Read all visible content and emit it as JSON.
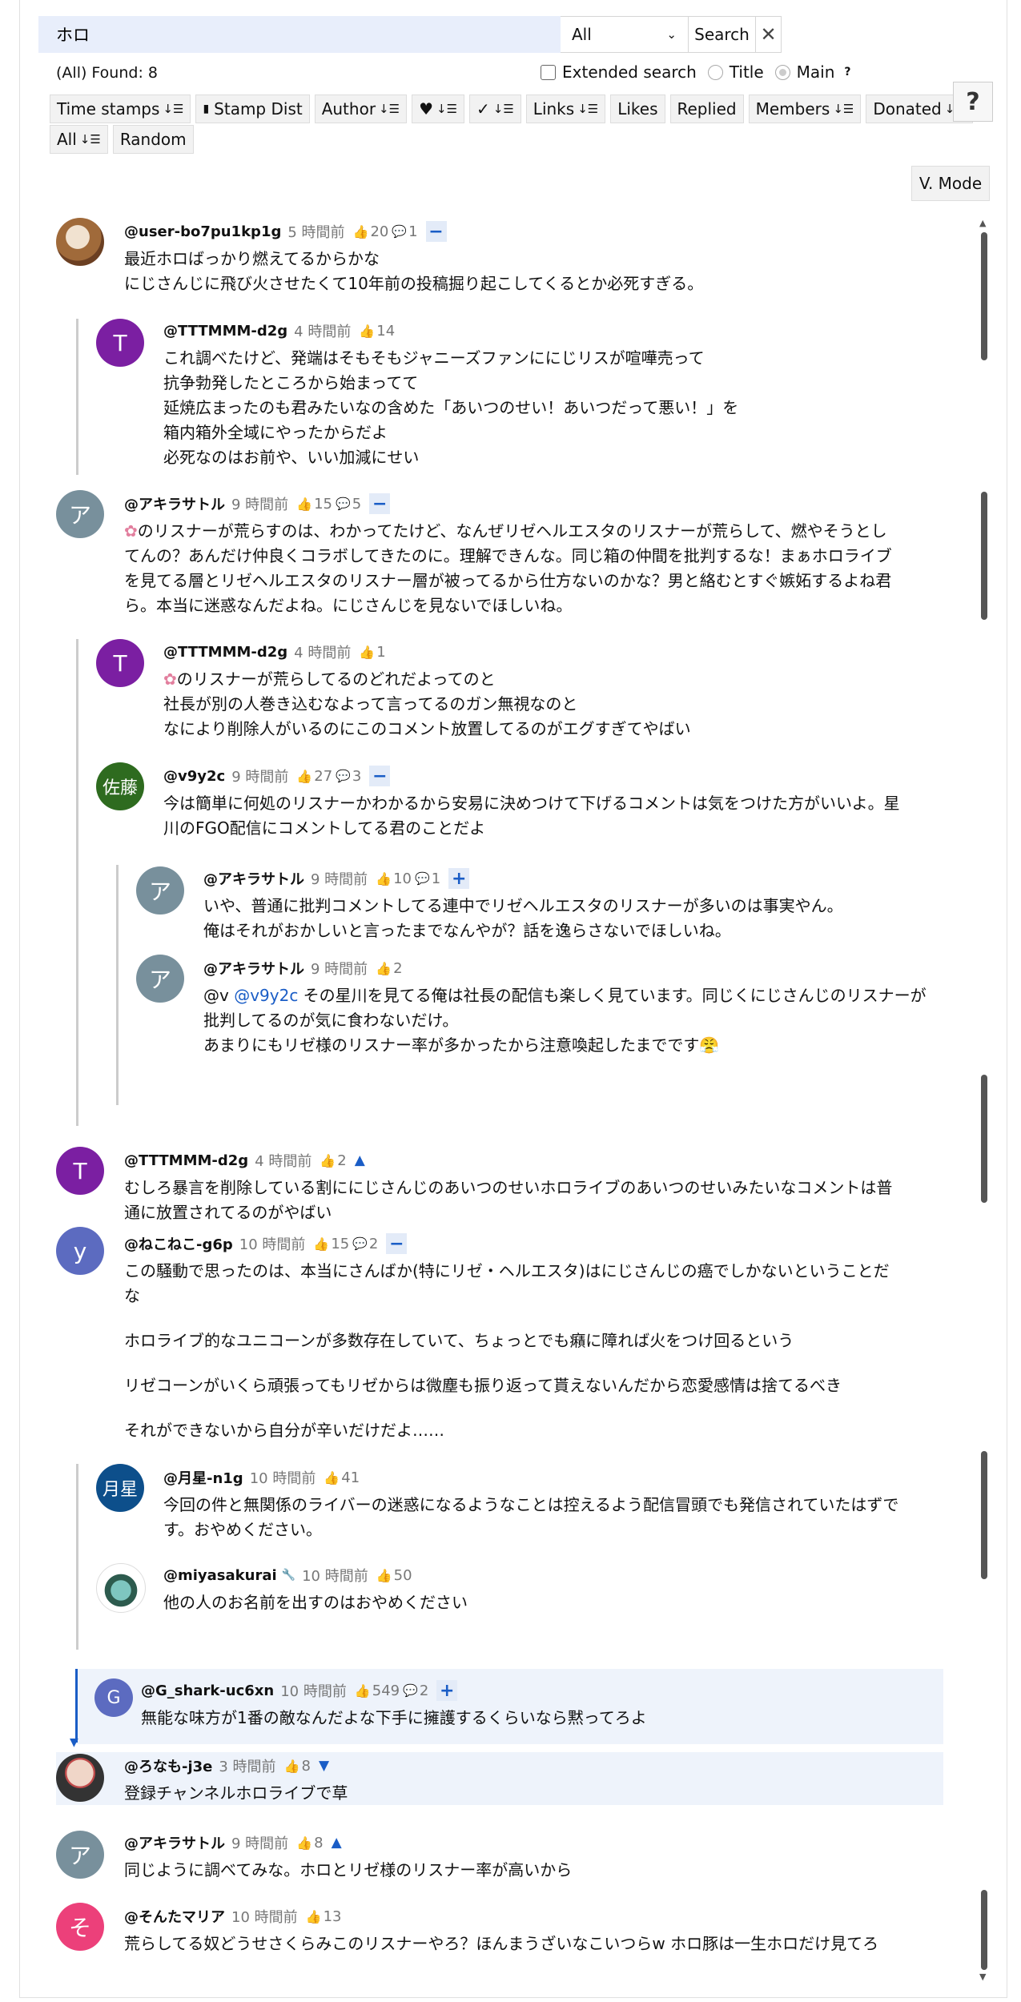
{
  "search": {
    "query": "ホロ",
    "scope": "All",
    "button": "Search",
    "clear": "✕"
  },
  "found_text": "(All) Found: 8",
  "options": {
    "extended": "Extended search",
    "title": "Title",
    "main": "Main",
    "help_q": "?"
  },
  "buttons_row1": [
    {
      "label": "Time stamps",
      "sort": "↓☰"
    },
    {
      "label": "Stamp Dist",
      "prefix": "▮"
    },
    {
      "label": "Author",
      "sort": "↓☰"
    },
    {
      "label": "♥",
      "sort": "↓☰"
    },
    {
      "label": "✓",
      "sort": "↓☰"
    },
    {
      "label": "Links",
      "sort": "↓☰"
    },
    {
      "label": "Likes"
    },
    {
      "label": "Replied"
    },
    {
      "label": "Members",
      "sort": "↓☰"
    },
    {
      "label": "Donated",
      "sort": "↓☰"
    }
  ],
  "buttons_row2": [
    {
      "label": "All",
      "sort": "↓☰"
    },
    {
      "label": "Random"
    }
  ],
  "help_button": "?",
  "vmode": "V. Mode",
  "comments": [
    {
      "author": "@user-bo7pu1kp1g",
      "time": "5 時間前",
      "likes": "20",
      "replies": "1",
      "toggle": "−",
      "lines": [
        "最近ホロばっかり燃えてるからかな",
        "にじさんじに飛び火させたくて10年前の投稿掘り起こしてくるとか必死すぎる。"
      ]
    },
    {
      "author": "@TTTMMM-d2g",
      "avatar": "T",
      "time": "4 時間前",
      "likes": "14",
      "lines": [
        "これ調べたけど、発端はそもそもジャニーズファンににじリスが喧嘩売って",
        "抗争勃発したところから始まってて",
        "延焼広まったのも君みたいなの含めた「あいつのせい！あいつだって悪い！」を",
        "箱内箱外全域にやったからだよ",
        "必死なのはお前や、いい加減にせい"
      ]
    },
    {
      "author": "@アキラサトル",
      "avatar": "ア",
      "time": "9 時間前",
      "likes": "15",
      "replies": "5",
      "toggle": "−",
      "lines": [
        "のリスナーが荒らすのは、わかってたけど、なんぜリゼヘルエスタのリスナーが荒らして、燃やそうとし",
        "てんの？あんだけ仲良くコラボしてきたのに。理解できんな。同じ箱の仲間を批判するな！まぁホロライブ",
        "を見てる層とリゼヘルエスタのリスナー層が被ってるから仕方ないのかな？男と絡むとすぐ嫉妬するよね君",
        "ら。本当に迷惑なんだよね。にじさんじを見ないでほしいね。"
      ]
    },
    {
      "author": "@TTTMMM-d2g",
      "avatar": "T",
      "time": "4 時間前",
      "likes": "1",
      "lines": [
        "のリスナーが荒らしてるのどれだよってのと",
        "社長が別の人巻き込むなよって言ってるのガン無視なのと",
        "なにより削除人がいるのにこのコメント放置してるのがエグすぎてやばい"
      ]
    },
    {
      "author": "@v9y2c",
      "avatar": "佐藤",
      "time": "9 時間前",
      "likes": "27",
      "replies": "3",
      "toggle": "−",
      "lines": [
        "今は簡単に何処のリスナーかわかるから安易に決めつけて下げるコメントは気をつけた方がいいよ。星",
        "川のFGO配信にコメントしてる君のことだよ"
      ]
    },
    {
      "author": "@アキラサトル",
      "avatar": "ア",
      "time": "9 時間前",
      "likes": "10",
      "replies": "1",
      "toggle": "+",
      "lines": [
        "いや、普通に批判コメントしてる連中でリゼヘルエスタのリスナーが多いのは事実やん。",
        "俺はそれがおかしいと言ったまでなんやが？話を逸らさないでほしいね。"
      ]
    },
    {
      "author": "@アキラサトル",
      "avatar": "ア",
      "time": "9 時間前",
      "likes": "2",
      "mention_prefix": "@v ",
      "mention": "@v9y2c",
      "lines": [
        " その星川を見てる俺は社長の配信も楽しく見ています。同じくにじさんじのリスナーが",
        "批判してるのが気に食わないだけ。",
        "あまりにもリゼ様のリスナー率が多かったから注意喚起したまでです😤"
      ]
    },
    {
      "author": "@TTTMMM-d2g",
      "avatar": "T",
      "time": "4 時間前",
      "likes": "2",
      "tri": "▲",
      "lines": [
        "むしろ暴言を削除している割ににじさんじのあいつのせいホロライブのあいつのせいみたいなコメントは普",
        "通に放置されてるのがやばい"
      ]
    },
    {
      "author": "@ねこねこ-g6p",
      "avatar": "y",
      "time": "10 時間前",
      "likes": "15",
      "replies": "2",
      "toggle": "−",
      "paras": [
        "この騒動で思ったのは、本当にさんばか(特にリゼ・ヘルエスタ)はにじさんじの癌でしかないということだ",
        "な",
        "ホロライブ的なユニコーンが多数存在していて、ちょっとでも癪に障れば火をつけ回るという",
        "リゼコーンがいくら頑張ってもリゼからは微塵も振り返って貰えないんだから恋愛感情は捨てるべき",
        "それができないから自分が辛いだけだよ……"
      ]
    },
    {
      "author": "@月星-n1g",
      "avatar": "月星",
      "time": "10 時間前",
      "likes": "41",
      "lines": [
        "今回の件と無関係のライバーの迷惑になるようなことは控えるよう配信冒頭でも発信されていたはずで",
        "す。おやめください。"
      ]
    },
    {
      "author": "@miyasakurai",
      "badge": "🔧",
      "time": "10 時間前",
      "likes": "50",
      "lines": [
        "他の人のお名前を出すのはおやめください"
      ]
    },
    {
      "author": "@G_shark-uc6xn",
      "avatar": "G",
      "time": "10 時間前",
      "likes": "549",
      "replies": "2",
      "toggle": "+",
      "lines": [
        "無能な味方が1番の敵なんだよな下手に擁護するくらいなら黙ってろよ"
      ]
    },
    {
      "author": "@ろなも-j3e",
      "time": "3 時間前",
      "likes": "8",
      "tri": "▼",
      "lines": [
        "登録チャンネルホロライブで草"
      ]
    },
    {
      "author": "@アキラサトル",
      "avatar": "ア",
      "time": "9 時間前",
      "likes": "8",
      "tri": "▲",
      "lines": [
        "同じように調べてみな。ホロとリゼ様のリスナー率が高いから"
      ]
    },
    {
      "author": "@そんたマリア",
      "avatar": "そ",
      "time": "10 時間前",
      "likes": "13",
      "lines": [
        "荒らしてる奴どうせさくらみこのリスナーやろ？ほんまうざいなこいつらw ホロ豚は一生ホロだけ見てろ"
      ]
    }
  ],
  "colors": {
    "accent": "#1a5dc6",
    "search_bg": "#e8eefb",
    "purple": "#7b1fa2",
    "gray": "#78909c",
    "green": "#2e6b1f",
    "indigo": "#5c6bc0",
    "navy": "#0d4f8b",
    "pink": "#ec407a"
  }
}
